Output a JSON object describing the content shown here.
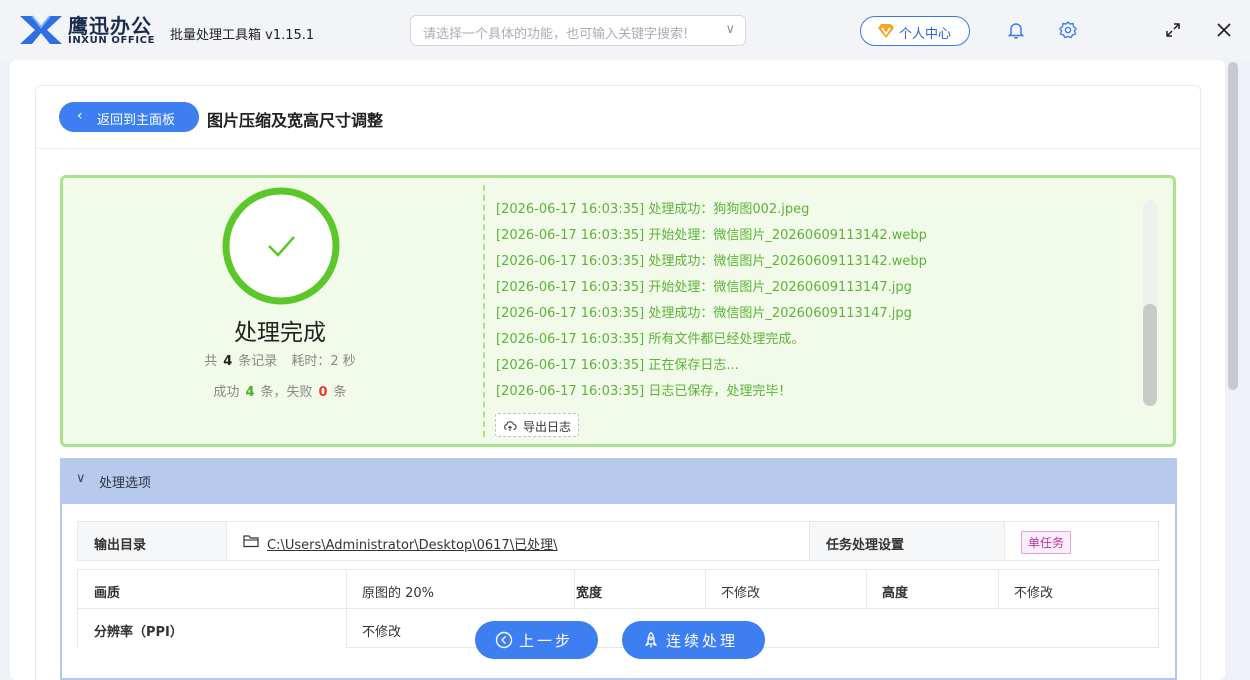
{
  "app": {
    "logo_cn": "鹰迅办公",
    "logo_en": "INXUN OFFICE",
    "title": "批量处理工具箱 v1.15.1",
    "search_placeholder": "请选择一个具体的功能，也可输入关键字搜索!",
    "user_center": "个人中心",
    "icons": [
      "bell-icon",
      "gear-icon",
      "maximize-icon",
      "close-icon"
    ]
  },
  "header": {
    "back_label": "返回到主面板",
    "page_title": "图片压缩及宽高尺寸调整"
  },
  "result": {
    "title": "处理完成",
    "total_prefix": "共",
    "total_count": "4",
    "total_suffix": "条记录",
    "time_prefix": "耗时：",
    "time_value": "2",
    "time_suffix": "秒",
    "success_prefix": "成功",
    "success_count": "4",
    "success_suffix": "条，失败",
    "fail_count": "0",
    "fail_suffix": "条",
    "accent_color": "#5cb338"
  },
  "log": {
    "lines": [
      "[2026-06-17 16:03:35] 处理成功：狗狗图002.jpeg",
      "[2026-06-17 16:03:35] 开始处理：微信图片_20260609113142.webp",
      "[2026-06-17 16:03:35] 处理成功：微信图片_20260609113142.webp",
      "[2026-06-17 16:03:35] 开始处理：微信图片_20260609113147.jpg",
      "[2026-06-17 16:03:35] 处理成功：微信图片_20260609113147.jpg",
      "[2026-06-17 16:03:35] 所有文件都已经处理完成。",
      "[2026-06-17 16:03:35] 正在保存日志...",
      "[2026-06-17 16:03:35] 日志已保存，处理完毕！"
    ],
    "export_label": "导出日志"
  },
  "options": {
    "section_label": "处理选项",
    "output_dir_label": "输出目录",
    "output_dir_value": "C:\\Users\\Administrator\\Desktop\\0617\\已处理\\",
    "task_setting_label": "任务处理设置",
    "task_setting_value": "单任务",
    "quality_label": "画质",
    "quality_value": "原图的 20%",
    "width_label": "宽度",
    "width_value": "不修改",
    "height_label": "高度",
    "height_value": "不修改",
    "ppi_label": "分辨率（PPI）",
    "ppi_value": "不修改"
  },
  "actions": {
    "prev_label": "上一步",
    "continue_label": "连续处理"
  }
}
